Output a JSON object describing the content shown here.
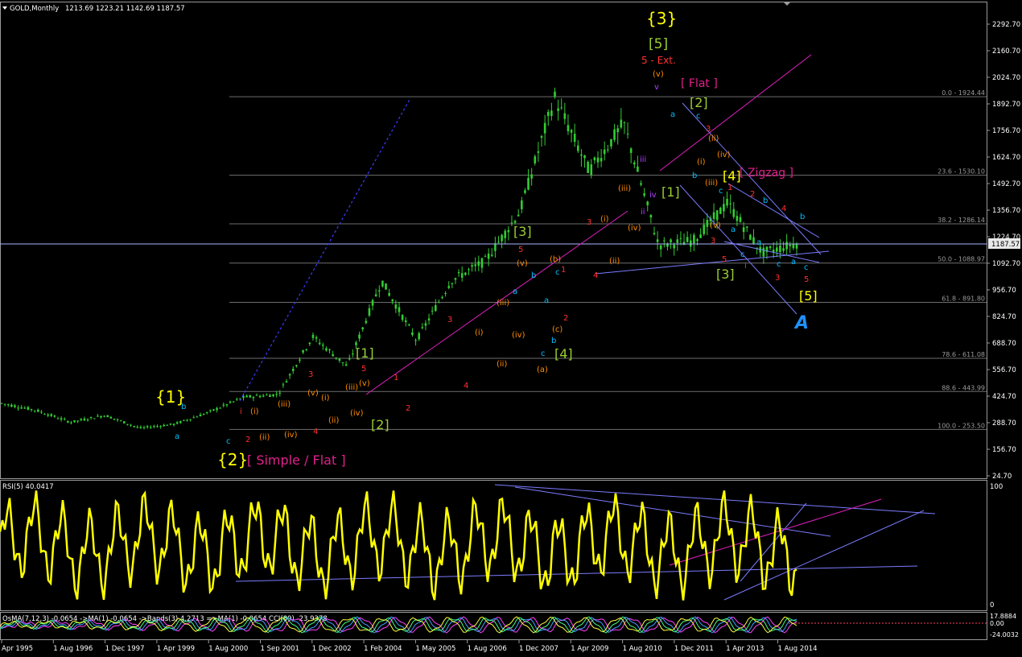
{
  "main": {
    "symbol": "GOLD,Monthly",
    "ohlc": "1213.69 1223.21 1142.69 1187.57",
    "price_axis": [
      "2292.70",
      "2160.70",
      "2024.70",
      "1892.70",
      "1756.70",
      "1624.70",
      "1492.70",
      "1356.70",
      "1224.70",
      "1092.70",
      "956.70",
      "824.70",
      "688.70",
      "556.70",
      "424.70",
      "288.70",
      "156.70",
      "24.70"
    ],
    "current_price": "1187.57",
    "fib_levels": [
      {
        "label": "0.0 - 1924.44",
        "value": 1924.44
      },
      {
        "label": "23.6 - 1530.10",
        "value": 1530.1
      },
      {
        "label": "38.2 - 1286.14",
        "value": 1286.14
      },
      {
        "label": "50.0 - 1088.97",
        "value": 1088.97
      },
      {
        "label": "61.8 - 891.80",
        "value": 891.8
      },
      {
        "label": "78.6 - 611.08",
        "value": 611.08
      },
      {
        "label": "88.6 - 443.99",
        "value": 443.99
      },
      {
        "label": "100.0 - 253.50",
        "value": 253.5
      }
    ],
    "colors": {
      "candles": "#32cd32",
      "fib": "#8c8c8c",
      "trendline": "#7b7bff",
      "magenta": "#e020c0",
      "rsi": "#ffff00",
      "hline": "#aab4ff"
    }
  },
  "rsi": {
    "title": "RSI(5) 40.0417",
    "scale": [
      "100",
      "0"
    ]
  },
  "osma": {
    "title": "OsMA(7,12,3) -0.0654 ->MA(1) -0.0654 ->Bands(3) 4.2713 =>MA(1) -0.0654 CCI(89) -23.9378",
    "scale": [
      "17.8884",
      "0.00",
      "-24.0032"
    ]
  },
  "time_axis": [
    "Apr 1995",
    "1 Aug 1996",
    "1 Dec 1997",
    "1 Apr 1999",
    "1 Aug 2000",
    "1 Sep 2001",
    "1 Dec 2002",
    "1 Feb 2004",
    "1 May 2005",
    "1 Aug 2006",
    "1 Dec 2007",
    "1 Apr 2009",
    "1 Aug 2010",
    "1 Dec 2011",
    "1 Apr 2013",
    "1 Aug 2014"
  ],
  "labels": {
    "big_3": "{3}",
    "big_5": "[5]",
    "ext": "5 - Ext.",
    "flat": "[ Flat ]",
    "zigzag": "[ Zigzag ]",
    "big_1": "{1}",
    "big_2": "{2}",
    "simple_flat": "[ Simple / Flat ]",
    "b1": "[1]",
    "b2": "[2]",
    "b3": "[3]",
    "b4": "[4]",
    "b5": "[5]",
    "a_logo": "A"
  },
  "chart_data": {
    "type": "line",
    "title": "GOLD,Monthly",
    "x": [
      "Jan 1995",
      "Jan 1997",
      "Jan 1999",
      "Aug 1999",
      "Apr 2001",
      "Jan 2002",
      "Jan 2003",
      "Dec 2003",
      "May 2005",
      "May 2006",
      "Nov 2006",
      "Mar 2008",
      "Oct 2008",
      "Aug 2009",
      "Dec 2009",
      "Jan 2011",
      "Sep 2011",
      "Dec 2011",
      "Aug 2012",
      "Jun 2013",
      "Dec 2013",
      "Mar 2014",
      "Nov 2014",
      "Jan 2015"
    ],
    "series": [
      {
        "values": [
          385,
          350,
          290,
          325,
          260,
          280,
          340,
          415,
          430,
          720,
          570,
          1000,
          700,
          1000,
          1100,
          1350,
          1920,
          1550,
          1790,
          1180,
          1200,
          1390,
          1140,
          1188
        ]
      }
    ],
    "ylim": [
      24.7,
      2292.7
    ]
  }
}
